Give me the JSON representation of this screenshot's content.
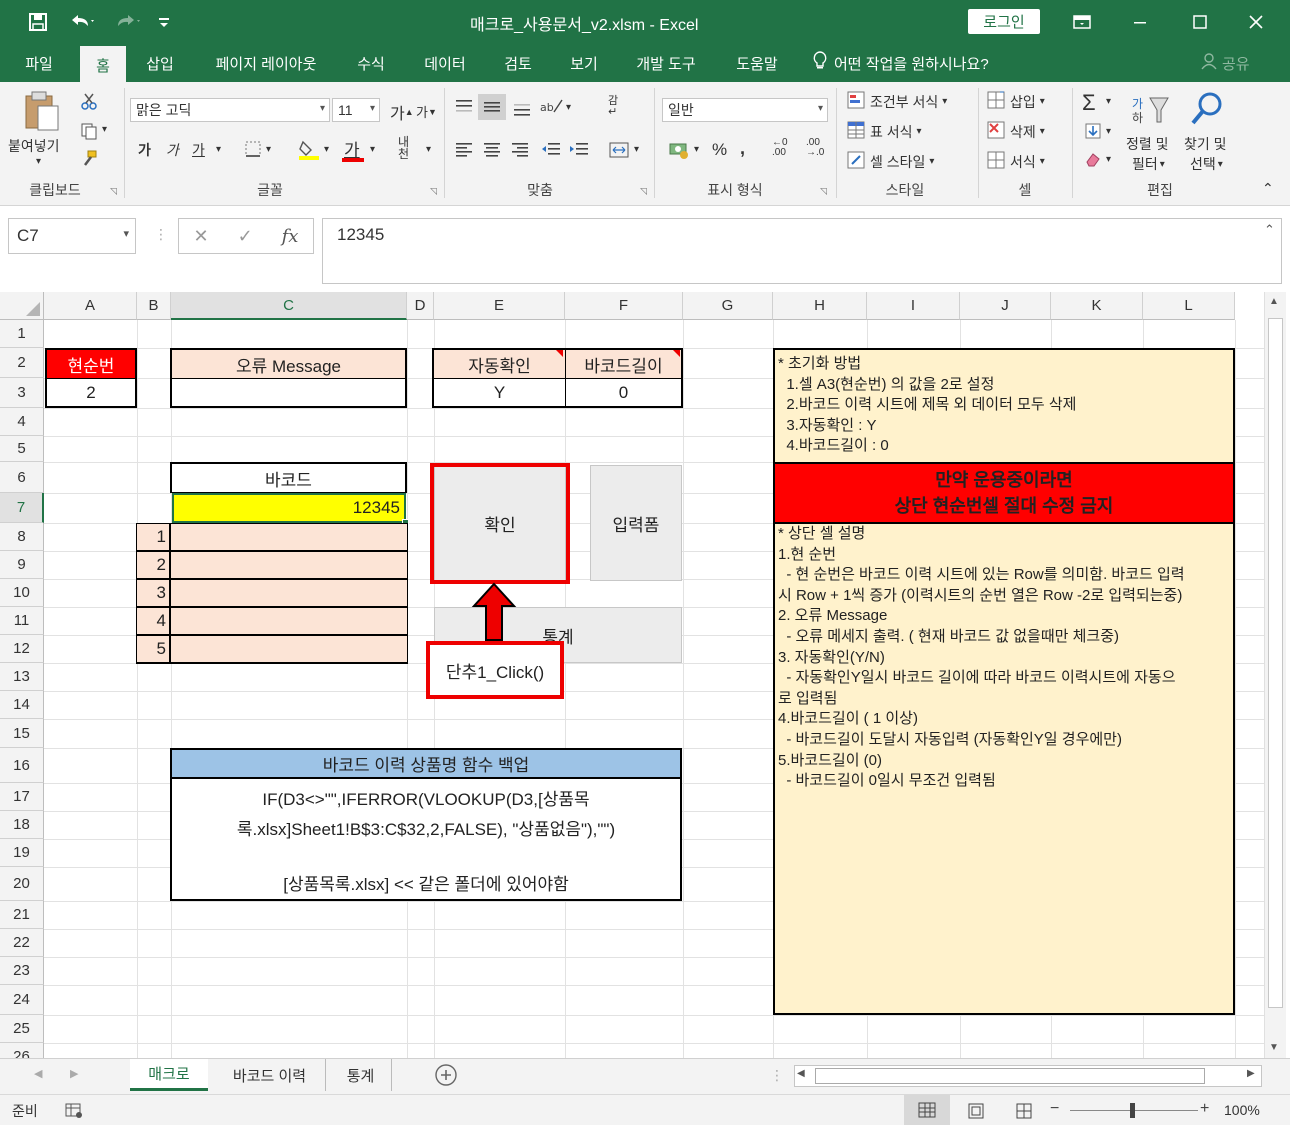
{
  "window": {
    "title": "매크로_사용문서_v2.xlsm  -  Excel",
    "login_label": "로그인"
  },
  "tabs": [
    "파일",
    "홈",
    "삽입",
    "페이지 레이아웃",
    "수식",
    "데이터",
    "검토",
    "보기",
    "개발 도구",
    "도움말"
  ],
  "tell_me": "어떤 작업을 원하시나요?",
  "share_label": "공유",
  "ribbon": {
    "clipboard": {
      "paste": "붙여넣기",
      "group": "클립보드"
    },
    "font": {
      "name": "맑은 고딕",
      "size": "11",
      "group": "글꼴"
    },
    "align": {
      "group": "맞춤"
    },
    "number": {
      "format": "일반",
      "group": "표시 형식"
    },
    "styles": {
      "cond": "조건부 서식",
      "table": "표 서식",
      "cell": "셀 스타일",
      "group": "스타일"
    },
    "cells": {
      "insert": "삽입",
      "delete": "삭제",
      "format": "서식",
      "group": "셀"
    },
    "editing": {
      "sort": "정렬 및",
      "filter": "필터",
      "find": "찾기 및",
      "select": "선택",
      "group": "편집"
    }
  },
  "formula_bar": {
    "name_box": "C7",
    "formula": "12345"
  },
  "columns": [
    "A",
    "B",
    "C",
    "D",
    "E",
    "F",
    "G",
    "H",
    "I",
    "J",
    "K",
    "L"
  ],
  "rows": [
    "1",
    "2",
    "3",
    "4",
    "5",
    "6",
    "7",
    "8",
    "9",
    "10",
    "11",
    "12",
    "13",
    "14",
    "15",
    "16",
    "17",
    "18",
    "19",
    "20",
    "21",
    "22",
    "23",
    "24",
    "25",
    "26"
  ],
  "sheet": {
    "a2": "현순번",
    "a3": "2",
    "c2": "오류 Message",
    "e2": "자동확인",
    "f2": "바코드길이",
    "e3": "Y",
    "f3": "0",
    "c6": "바코드",
    "c7": "12345",
    "b_numbers": [
      "1",
      "2",
      "3",
      "4",
      "5"
    ],
    "btn_confirm": "확인",
    "btn_input": "입력폼",
    "btn_stats": "통계",
    "callout": "단추1_Click()",
    "backup_title": "바코드 이력 상품명 함수 백업",
    "backup_line1": "IF(D3<>\"\",IFERROR(VLOOKUP(D3,[상품목",
    "backup_line2": "록.xlsx]Sheet1!B$3:C$32,2,FALSE), \"상품없음\"),\"\")",
    "backup_line3": "[상품목록.xlsx] << 같은 폴더에 있어야함",
    "init_notes": [
      "* 초기화 방법",
      "  1.셀 A3(현순번) 의 값을 2로 설정",
      "  2.바코드 이력 시트에 제목 외 데이터 모두 삭제",
      "  3.자동확인 : Y",
      "  4.바코드길이 : 0"
    ],
    "warning_line1": "만약 운용중이라면",
    "warning_line2": "상단 현순번셀 절대 수정 금지",
    "desc_notes": [
      "* 상단 셀 설명",
      "1.현 순번",
      "  - 현 순번은 바코드 이력 시트에 있는 Row를 의미함. 바코드 입력",
      "시 Row + 1씩 증가 (이력시트의 순번 열은 Row -2로 입력되는중)",
      "2. 오류 Message",
      "  - 오류 메세지 출력. ( 현재 바코드 값 없을때만 체크중)",
      "3. 자동확인(Y/N)",
      "  - 자동확인Y일시 바코드 길이에 따라 바코드 이력시트에 자동으",
      "로 입력됨",
      "4.바코드길이 ( 1 이상)",
      "  - 바코드길이 도달시 자동입력 (자동확인Y일 경우에만)",
      "5.바코드길이 (0)",
      "  - 바코드길이 0일시 무조건 입력됨"
    ]
  },
  "sheet_tabs": [
    "매크로",
    "바코드 이력",
    "통계"
  ],
  "status": {
    "mode": "준비",
    "zoom": "100%"
  },
  "colors": {
    "accent": "#217346",
    "red": "#ee0000",
    "peach": "#fce4d6",
    "note_bg": "#fff2cc",
    "yellow": "#ffff00",
    "blue_header": "#9dc3e6"
  }
}
